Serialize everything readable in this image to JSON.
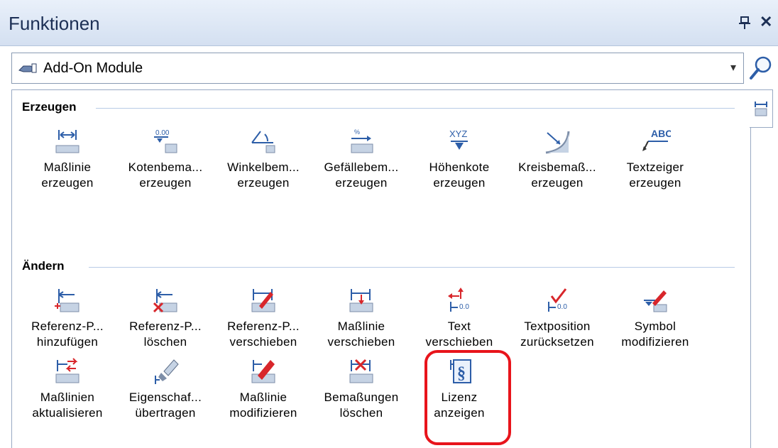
{
  "window": {
    "title": "Funktionen",
    "pin_glyph": "ᵖ",
    "close_glyph": "✕"
  },
  "combo": {
    "value": "Add-On Module",
    "icon": "add-on-module-icon",
    "arrow_glyph": "▾"
  },
  "sections": [
    {
      "title": "Erzeugen",
      "items": [
        {
          "label": "Maßlinie\nerzeugen",
          "icon": "dimension-line-icon"
        },
        {
          "label": "Kotenbema...\nerzeugen",
          "icon": "elevation-dimension-icon"
        },
        {
          "label": "Winkelbem...\nerzeugen",
          "icon": "angle-dimension-icon"
        },
        {
          "label": "Gefällebem...\nerzeugen",
          "icon": "slope-dimension-icon"
        },
        {
          "label": "Höhenkote\nerzeugen",
          "icon": "height-marker-icon"
        },
        {
          "label": "Kreisbemaß...\nerzeugen",
          "icon": "arc-dimension-icon"
        },
        {
          "label": "Textzeiger\nerzeugen",
          "icon": "text-pointer-icon"
        }
      ]
    },
    {
      "title": "Ändern",
      "items": [
        {
          "label": "Referenz-P...\nhinzufügen",
          "icon": "add-reference-point-icon"
        },
        {
          "label": "Referenz-P...\nlöschen",
          "icon": "delete-reference-point-icon"
        },
        {
          "label": "Referenz-P...\nverschieben",
          "icon": "move-reference-point-icon"
        },
        {
          "label": "Maßlinie\nverschieben",
          "icon": "move-dimension-line-icon"
        },
        {
          "label": "Text\nverschieben",
          "icon": "move-text-icon"
        },
        {
          "label": "Textposition\nzurücksetzen",
          "icon": "reset-text-position-icon"
        },
        {
          "label": "Symbol\nmodifizieren",
          "icon": "modify-symbol-icon"
        },
        {
          "label": "Maßlinien\naktualisieren",
          "icon": "update-dimension-lines-icon"
        },
        {
          "label": "Eigenschaf...\nübertragen",
          "icon": "transfer-properties-icon"
        },
        {
          "label": "Maßlinie\nmodifizieren",
          "icon": "modify-dimension-line-icon"
        },
        {
          "label": "Bemaßungen\nlöschen",
          "icon": "delete-dimensions-icon"
        },
        {
          "label": "Lizenz\nanzeigen",
          "icon": "license-icon"
        }
      ]
    }
  ],
  "colors": {
    "accent_blue": "#2d5ea8",
    "icon_red": "#d8262b",
    "highlight_red": "#e8141b"
  }
}
